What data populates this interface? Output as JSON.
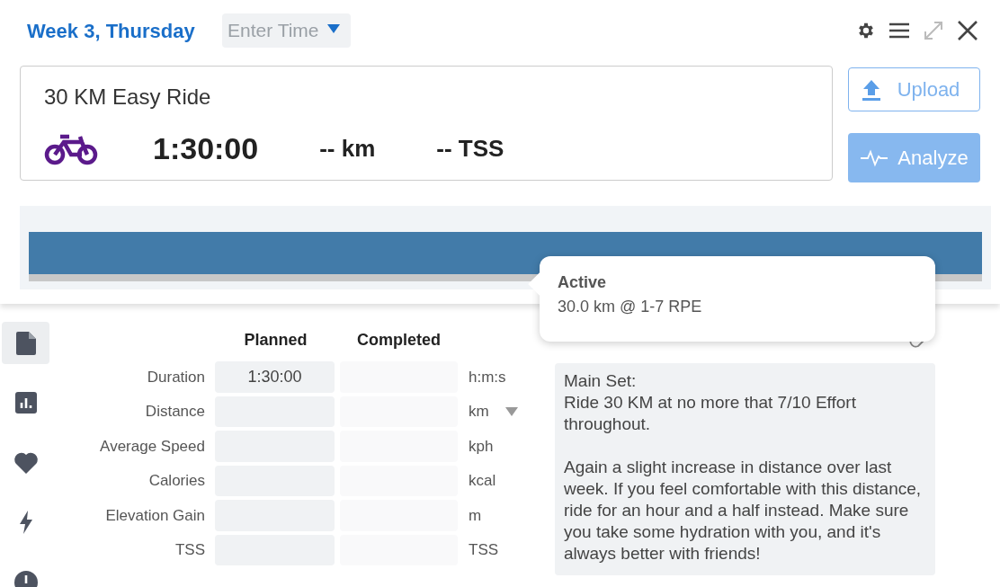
{
  "header": {
    "title": "Week 3, Thursday",
    "time_placeholder": "Enter Time"
  },
  "workout": {
    "title": "30 KM Easy Ride",
    "duration": "1:30:00",
    "distance": "-- km",
    "tss": "-- TSS"
  },
  "actions": [
    {
      "label": "Upload",
      "kind": "upload"
    },
    {
      "label": "Analyze",
      "kind": "analyze"
    }
  ],
  "tooltip": {
    "title": "Active",
    "text": "30.0 km @ 1-7 RPE"
  },
  "sidebar": {
    "items": [
      {
        "kind": "document",
        "selected": true
      },
      {
        "kind": "chart",
        "selected": false
      },
      {
        "kind": "heart",
        "selected": false
      },
      {
        "kind": "bolt",
        "selected": false
      },
      {
        "kind": "clock",
        "selected": false
      }
    ]
  },
  "table": {
    "columns": [
      "Planned",
      "Completed"
    ],
    "rows": [
      {
        "label": "Duration",
        "planned": "1:30:00",
        "unit": "h:m:s",
        "dropdown": false
      },
      {
        "label": "Distance",
        "unit": "km",
        "dropdown": true
      },
      {
        "label": "Average Speed",
        "unit": "kph",
        "dropdown": false
      },
      {
        "label": "Calories",
        "unit": "kcal",
        "dropdown": false
      },
      {
        "label": "Elevation Gain",
        "unit": "m",
        "dropdown": false
      },
      {
        "label": "TSS",
        "unit": "TSS",
        "dropdown": false
      }
    ]
  },
  "description": {
    "paragraphs": [
      "Main Set:\nRide 30 KM at no more that 7/10 Effort throughout.",
      "Again a slight increase in distance over last week. If you feel comfortable with this distance, ride for an hour and a half instead. Make sure you take some hydration with you, and it's always better with friends!"
    ]
  }
}
